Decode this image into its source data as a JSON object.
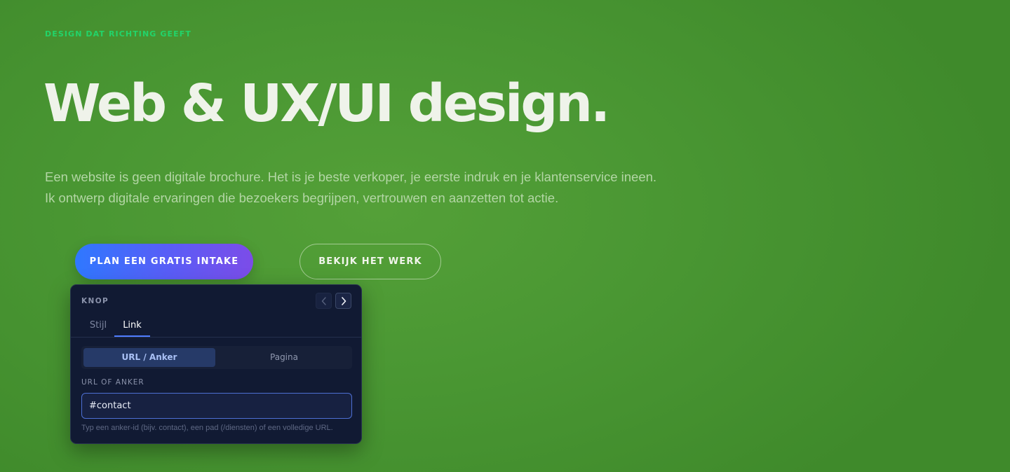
{
  "hero": {
    "eyebrow": "DESIGN DAT RICHTING GEEFT",
    "title": "Web & UX/UI design.",
    "text_line1": "Een website is geen digitale brochure. Het is je beste verkoper, je eerste indruk en je klantenservice ineen.",
    "text_line2": "Ik ontwerp digitale ervaringen die bezoekers begrijpen, vertrouwen en aanzetten tot actie.",
    "primary_button": "PLAN EEN GRATIS INTAKE",
    "secondary_button": "BEKIJK HET WERK"
  },
  "panel": {
    "title": "KNOP",
    "nav_prev_icon": "chevron-left-icon",
    "nav_next_icon": "chevron-right-icon",
    "tabs": [
      "Stijl",
      "Link"
    ],
    "active_tab": "Link",
    "segments": [
      "URL / Anker",
      "Pagina"
    ],
    "active_segment": "URL / Anker",
    "field_label": "URL OF ANKER",
    "field_value": "#contact",
    "hint": "Typ een anker-id (bijv. contact), een pad (/diensten) of een volledige URL."
  },
  "colors": {
    "background": "#4a9733",
    "eyebrow": "#22d46a",
    "primary_gradient_start": "#2f78ff",
    "primary_gradient_end": "#7c4ce8",
    "panel_bg": "#111a33",
    "accent": "#4f7cff"
  }
}
